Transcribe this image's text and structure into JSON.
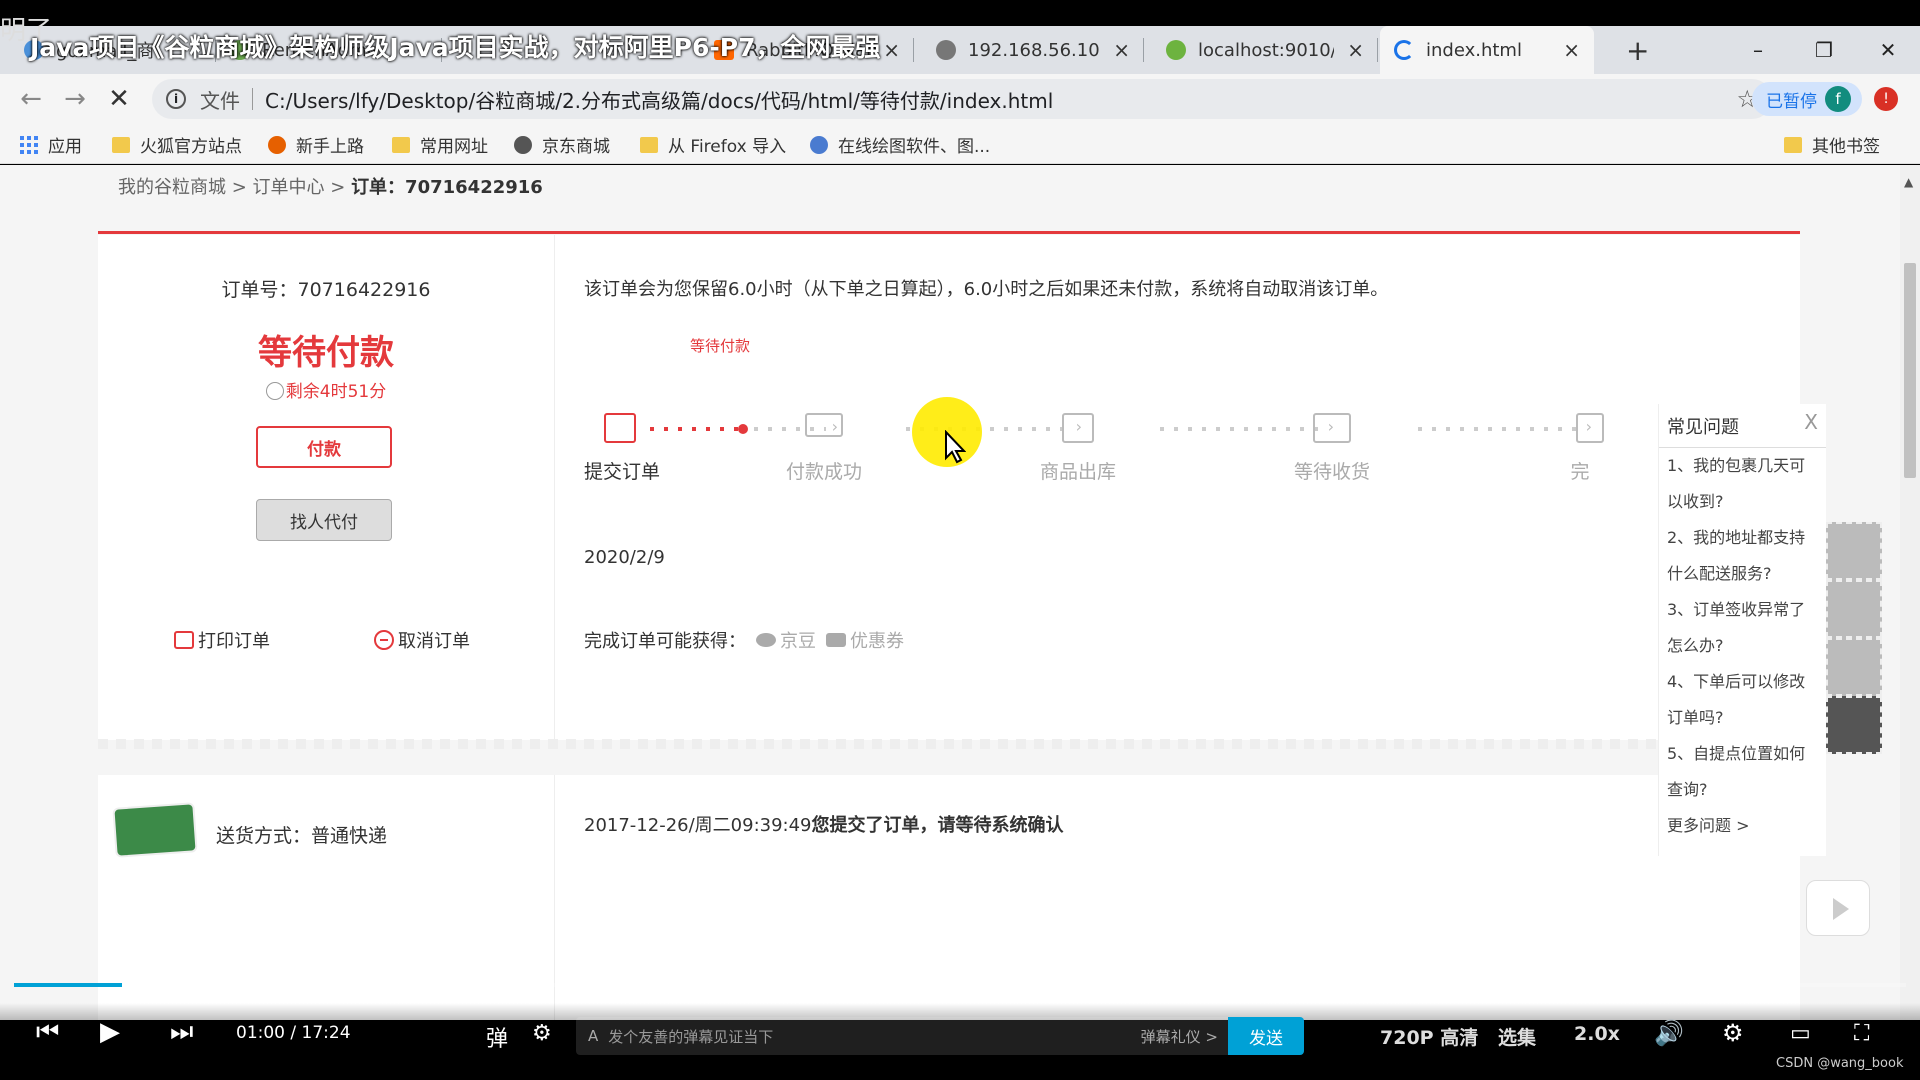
{
  "video": {
    "title": "Java项目《谷粒商城》架构师级Java项目实战，对标阿里P6-P7，全网最强",
    "corner_text": "明了"
  },
  "tabs": [
    {
      "label": "gulimall_商",
      "close": "×"
    },
    {
      "label": "RenrenAdmin",
      "close": "×"
    },
    {
      "label": "RabbitMQ Mana",
      "close": "×"
    },
    {
      "label": "192.168.56.10",
      "close": "×"
    },
    {
      "label": "localhost:9010/s",
      "close": "×"
    },
    {
      "label": "index.html",
      "close": "×",
      "active": true
    }
  ],
  "new_tab": "+",
  "window_controls": {
    "minimize": "–",
    "restore": "❐",
    "close": "✕",
    "help": "?"
  },
  "toolbar": {
    "back": "←",
    "forward": "→",
    "stop": "✕",
    "scheme": "文件",
    "url": "C:/Users/lfy/Desktop/谷粒商城/2.分布式高级篇/docs/代码/html/等待付款/index.html",
    "star": "☆",
    "paused_label": "已暂停",
    "avatar_letter": "f",
    "update_badge": "!"
  },
  "bookmarks": {
    "items": [
      "应用",
      "火狐官方站点",
      "新手上路",
      "常用网址",
      "京东商城",
      "从 Firefox 导入",
      "在线绘图软件、图..."
    ],
    "other": "其他书签"
  },
  "breadcrumb": {
    "part1": "我的谷粒商城",
    "sep": " > ",
    "part2": "订单中心",
    "part3": "订单：70716422916"
  },
  "order": {
    "order_no": "订单号：70716422916",
    "status": "等待付款",
    "remaining": "剩余4时51分",
    "pay_button": "付款",
    "friend_pay_button": "找人代付",
    "print": "打印订单",
    "cancel": "取消订单"
  },
  "progress": {
    "notice": "该订单会为您保留6.0小时（从下单之日算起），6.0小时之后如果还未付款，系统将自动取消该订单。",
    "current_hint": "等待付款",
    "steps": [
      "提交订单",
      "付款成功",
      "商品出库",
      "等待收货",
      "完"
    ],
    "date": "2020/2/9",
    "rewards_label": "完成订单可能获得：",
    "reward1": "京豆",
    "reward2": "优惠券"
  },
  "shipping": {
    "method": "送货方式：普通快递",
    "log_time": "2017-12-26/周二09:39:49",
    "log_text": "您提交了订单，请等待系统确认"
  },
  "faq": {
    "title": "常见问题",
    "close": "X",
    "items": [
      "1、我的包裹几天可",
      "以收到?",
      "2、我的地址都支持",
      "什么配送服务?",
      "3、订单签收异常了",
      "怎么办?",
      "4、下单后可以修改",
      "订单吗?",
      "5、自提点位置如何",
      "查询?"
    ],
    "more": "更多问题 >"
  },
  "player": {
    "current_time": "01:00",
    "total_time": "17:24",
    "time_sep": " / ",
    "danmaku_placeholder": "发个友善的弹幕见证当下",
    "gift": "弹幕礼仪 >",
    "send": "发送",
    "quality": "720P 高清",
    "episodes": "选集",
    "speed": "2.0x",
    "progress_fraction": 0.057
  },
  "watermark": "CSDN @wang_book",
  "colors": {
    "accent_red": "#e4393c",
    "player_blue": "#00a1d6"
  }
}
